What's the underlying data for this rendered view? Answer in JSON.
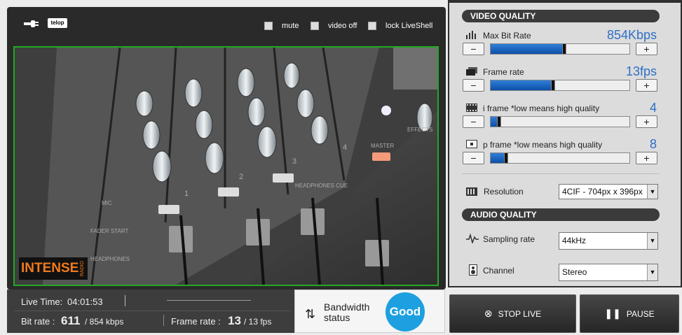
{
  "topbar": {
    "icons": [
      "plug-icon",
      "telop-icon"
    ],
    "telop_label": "telop",
    "checkboxes": [
      {
        "label": "mute",
        "checked": false
      },
      {
        "label": "video off",
        "checked": false
      },
      {
        "label": "lock LiveShell",
        "checked": false
      }
    ]
  },
  "video": {
    "logo_main": "INTENSE",
    "logo_sub": "RADIO",
    "border_color": "#22aa22",
    "mixer_labels": [
      "1",
      "2",
      "3",
      "4",
      "HEADPHONES CUE",
      "MASTER",
      "EFFECTS",
      "FADER START",
      "HEADPHONES",
      "MIC"
    ]
  },
  "status": {
    "live_time_label": "Live Time:",
    "live_time": "04:01:53",
    "bitrate_label": "Bit rate :",
    "bitrate_value": "611",
    "bitrate_max": "/ 854 kbps",
    "framerate_label": "Frame rate :",
    "framerate_value": "13",
    "framerate_max": "/ 13 fps",
    "bandwidth_label": "Bandwidth",
    "bandwidth_label2": "status",
    "bandwidth_state": "Good"
  },
  "video_quality": {
    "title": "VIDEO QUALITY",
    "rows": [
      {
        "icon": "bars-icon",
        "label": "Max Bit Rate",
        "value": "854Kbps",
        "level": 0.52
      },
      {
        "icon": "frames-icon",
        "label": "Frame rate",
        "value": "13fps",
        "level": 0.44
      },
      {
        "icon": "film-icon",
        "label": "i frame *low means high quality",
        "value": "4",
        "level": 0.05
      },
      {
        "icon": "pframe-icon",
        "label": "p frame *low means high quality",
        "value": "8",
        "level": 0.1
      }
    ],
    "minus": "−",
    "plus": "+",
    "resolution_label": "Resolution",
    "resolution_value": "4CIF - 704px x 396px"
  },
  "audio_quality": {
    "title": "AUDIO QUALITY",
    "sampling_label": "Sampling rate",
    "sampling_value": "44kHz",
    "channel_label": "Channel",
    "channel_value": "Stereo"
  },
  "actions": {
    "stop_label": "STOP LIVE",
    "pause_label": "PAUSE"
  },
  "colors": {
    "accent": "#1ea0e0",
    "slider": "#1565c0",
    "value": "#2f6fc6"
  }
}
